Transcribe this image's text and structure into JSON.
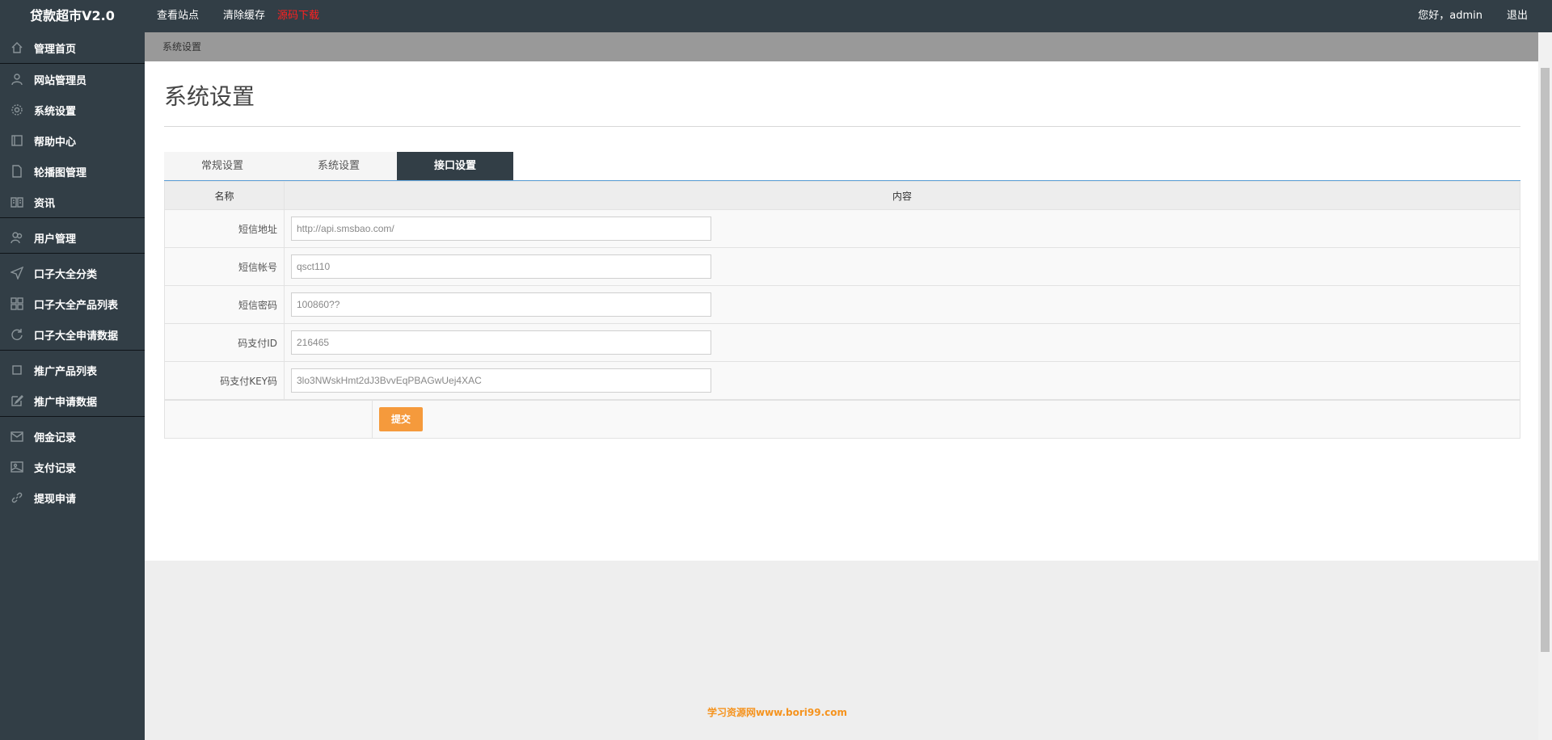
{
  "brand": "贷款超市V2.0",
  "topnav": [
    "查看站点",
    "清除缓存",
    "源码下载"
  ],
  "topright": {
    "greeting": "您好，admin",
    "logout": "退出"
  },
  "sidebar": {
    "items": [
      {
        "label": "管理首页",
        "icon": "home-icon"
      },
      {
        "label": "网站管理员",
        "icon": "user-icon"
      },
      {
        "label": "系统设置",
        "icon": "gear-icon"
      },
      {
        "label": "帮助中心",
        "icon": "book-icon"
      },
      {
        "label": "轮播图管理",
        "icon": "file-icon"
      },
      {
        "label": "资讯",
        "icon": "news-icon"
      },
      {
        "label": "用户管理",
        "icon": "users-icon"
      },
      {
        "label": "口子大全分类",
        "icon": "send-icon"
      },
      {
        "label": "口子大全产品列表",
        "icon": "grid-icon"
      },
      {
        "label": "口子大全申请数据",
        "icon": "refresh-icon"
      },
      {
        "label": "推广产品列表",
        "icon": "square-icon"
      },
      {
        "label": "推广申请数据",
        "icon": "edit-icon"
      },
      {
        "label": "佣金记录",
        "icon": "inbox-icon"
      },
      {
        "label": "支付记录",
        "icon": "image-icon"
      },
      {
        "label": "提现申请",
        "icon": "link-icon"
      }
    ]
  },
  "breadcrumb": "系统设置",
  "page_title": "系统设置",
  "tabs": [
    {
      "label": "常规设置",
      "active": false
    },
    {
      "label": "系统设置",
      "active": false
    },
    {
      "label": "接口设置",
      "active": true
    }
  ],
  "table": {
    "headers": [
      "名称",
      "内容"
    ],
    "rows": [
      {
        "label": "短信地址",
        "value": "http://api.smsbao.com/"
      },
      {
        "label": "短信帐号",
        "value": "qsct110"
      },
      {
        "label": "短信密码",
        "value": "100860??"
      },
      {
        "label": "码支付ID",
        "value": "216465"
      },
      {
        "label": "码支付KEY码",
        "value": "3lo3NWskHmt2dJ3BvvEqPBAGwUej4XAC"
      }
    ]
  },
  "submit_label": "提交",
  "watermark": "学习资源网www.bori99.com",
  "colors": {
    "topbar": "#323e46",
    "accent_button": "#f59a3c",
    "download_link": "#ff2020"
  }
}
